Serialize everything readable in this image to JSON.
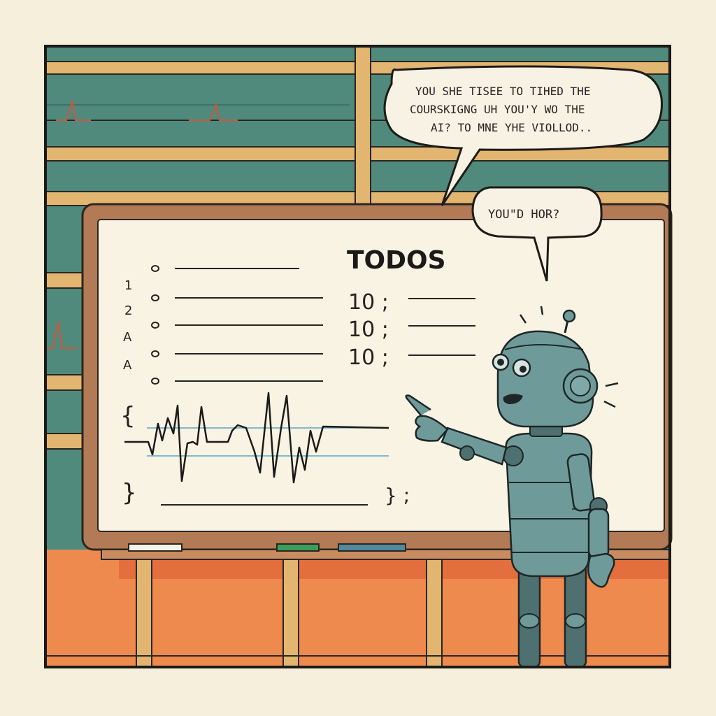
{
  "speech_bubble_1": {
    "line_1": "YOU SHE TISEE TO TIHED THE",
    "line_2": "COURSKIGNG UH YOU'Y WO THE",
    "line_3": "AI? TO MNE YHE VIOLLOD.."
  },
  "speech_bubble_2": {
    "text": "YOU\"D HOR?"
  },
  "whiteboard": {
    "title": "TODOS",
    "left_numbers": [
      "1",
      "2",
      "A",
      "A"
    ],
    "counts": [
      "10 ;",
      "10 ;",
      "10 ;"
    ],
    "open_brace": "{",
    "close_brace": "}",
    "closing": "} ;"
  },
  "colors": {
    "background": "#f6efdc",
    "wall_teal": "#4f8a7c",
    "shelf_tan": "#e2b571",
    "floor_orange": "#ee8a4e",
    "board_frame": "#b27a55",
    "board_surface": "#f8f3e3",
    "robot_body": "#6f9a9a",
    "robot_dark": "#4e7070"
  }
}
